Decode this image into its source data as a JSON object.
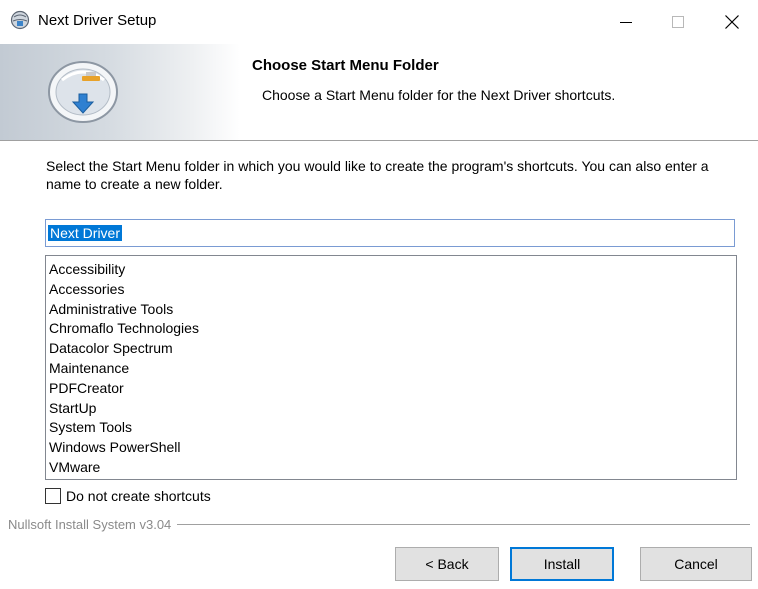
{
  "window": {
    "title": "Next Driver Setup",
    "controls": {
      "minimize": "minimize-icon",
      "maximize": "maximize-icon",
      "close": "close-icon"
    }
  },
  "header": {
    "title": "Choose Start Menu Folder",
    "subtitle": "Choose a Start Menu folder for the Next Driver shortcuts."
  },
  "body": {
    "description": "Select the Start Menu folder in which you would like to create the program's shortcuts. You can also enter a name to create a new folder.",
    "folder_input": {
      "value": "Next Driver"
    },
    "folders": [
      "Accessibility",
      "Accessories",
      "Administrative Tools",
      "Chromaflo Technologies",
      "Datacolor Spectrum",
      "Maintenance",
      "PDFCreator",
      "StartUp",
      "System Tools",
      "Windows PowerShell",
      "VMware"
    ],
    "checkbox": {
      "label": "Do not create shortcuts",
      "checked": false
    }
  },
  "footer": {
    "branding": "Nullsoft Install System v3.04",
    "back_label": "< Back",
    "install_label": "Install",
    "cancel_label": "Cancel"
  },
  "colors": {
    "accent": "#0078d7",
    "button_face": "#e1e1e1",
    "branding_text": "#8a8a8a"
  }
}
